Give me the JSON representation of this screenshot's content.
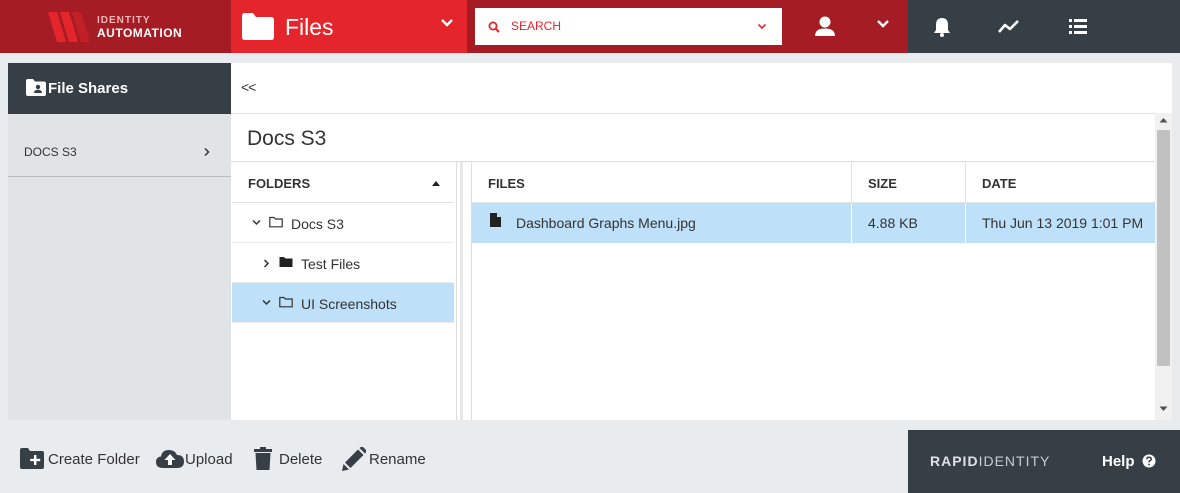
{
  "brand": {
    "logo_line1": "IDENTITY",
    "logo_line2": "AUTOMATION",
    "colors": {
      "primary_red": "#e4262c",
      "dark_red": "#a51c24",
      "slate": "#353f45",
      "selection_blue": "#bee0f8"
    }
  },
  "header": {
    "module_title": "Files",
    "module_icon": "folder-icon",
    "search_placeholder": "SEARCH",
    "user_icon": "user-icon",
    "tool_icons": [
      "bell-icon",
      "activity-chart-icon",
      "list-icon"
    ]
  },
  "sidebar": {
    "title": "File Shares",
    "items": [
      {
        "label": "DOCS S3"
      }
    ]
  },
  "main": {
    "collapse_label": "<<",
    "page_title": "Docs S3",
    "folders": {
      "header": "FOLDERS",
      "items": [
        {
          "label": "Docs S3",
          "expanded": true,
          "selected": false
        },
        {
          "label": "Test Files",
          "expanded": false,
          "selected": false
        },
        {
          "label": "UI Screenshots",
          "expanded": true,
          "selected": true
        }
      ]
    },
    "files": {
      "columns": [
        "FILES",
        "SIZE",
        "DATE"
      ],
      "rows": [
        {
          "name": "Dashboard Graphs Menu.jpg",
          "size": "4.88 KB",
          "date": "Thu Jun 13 2019 1:01 PM",
          "selected": true
        }
      ]
    }
  },
  "footer": {
    "actions": [
      "Create Folder",
      "Upload",
      "Delete",
      "Rename"
    ],
    "brand_bold": "RAPID",
    "brand_light": "IDENTITY",
    "help_label": "Help"
  }
}
